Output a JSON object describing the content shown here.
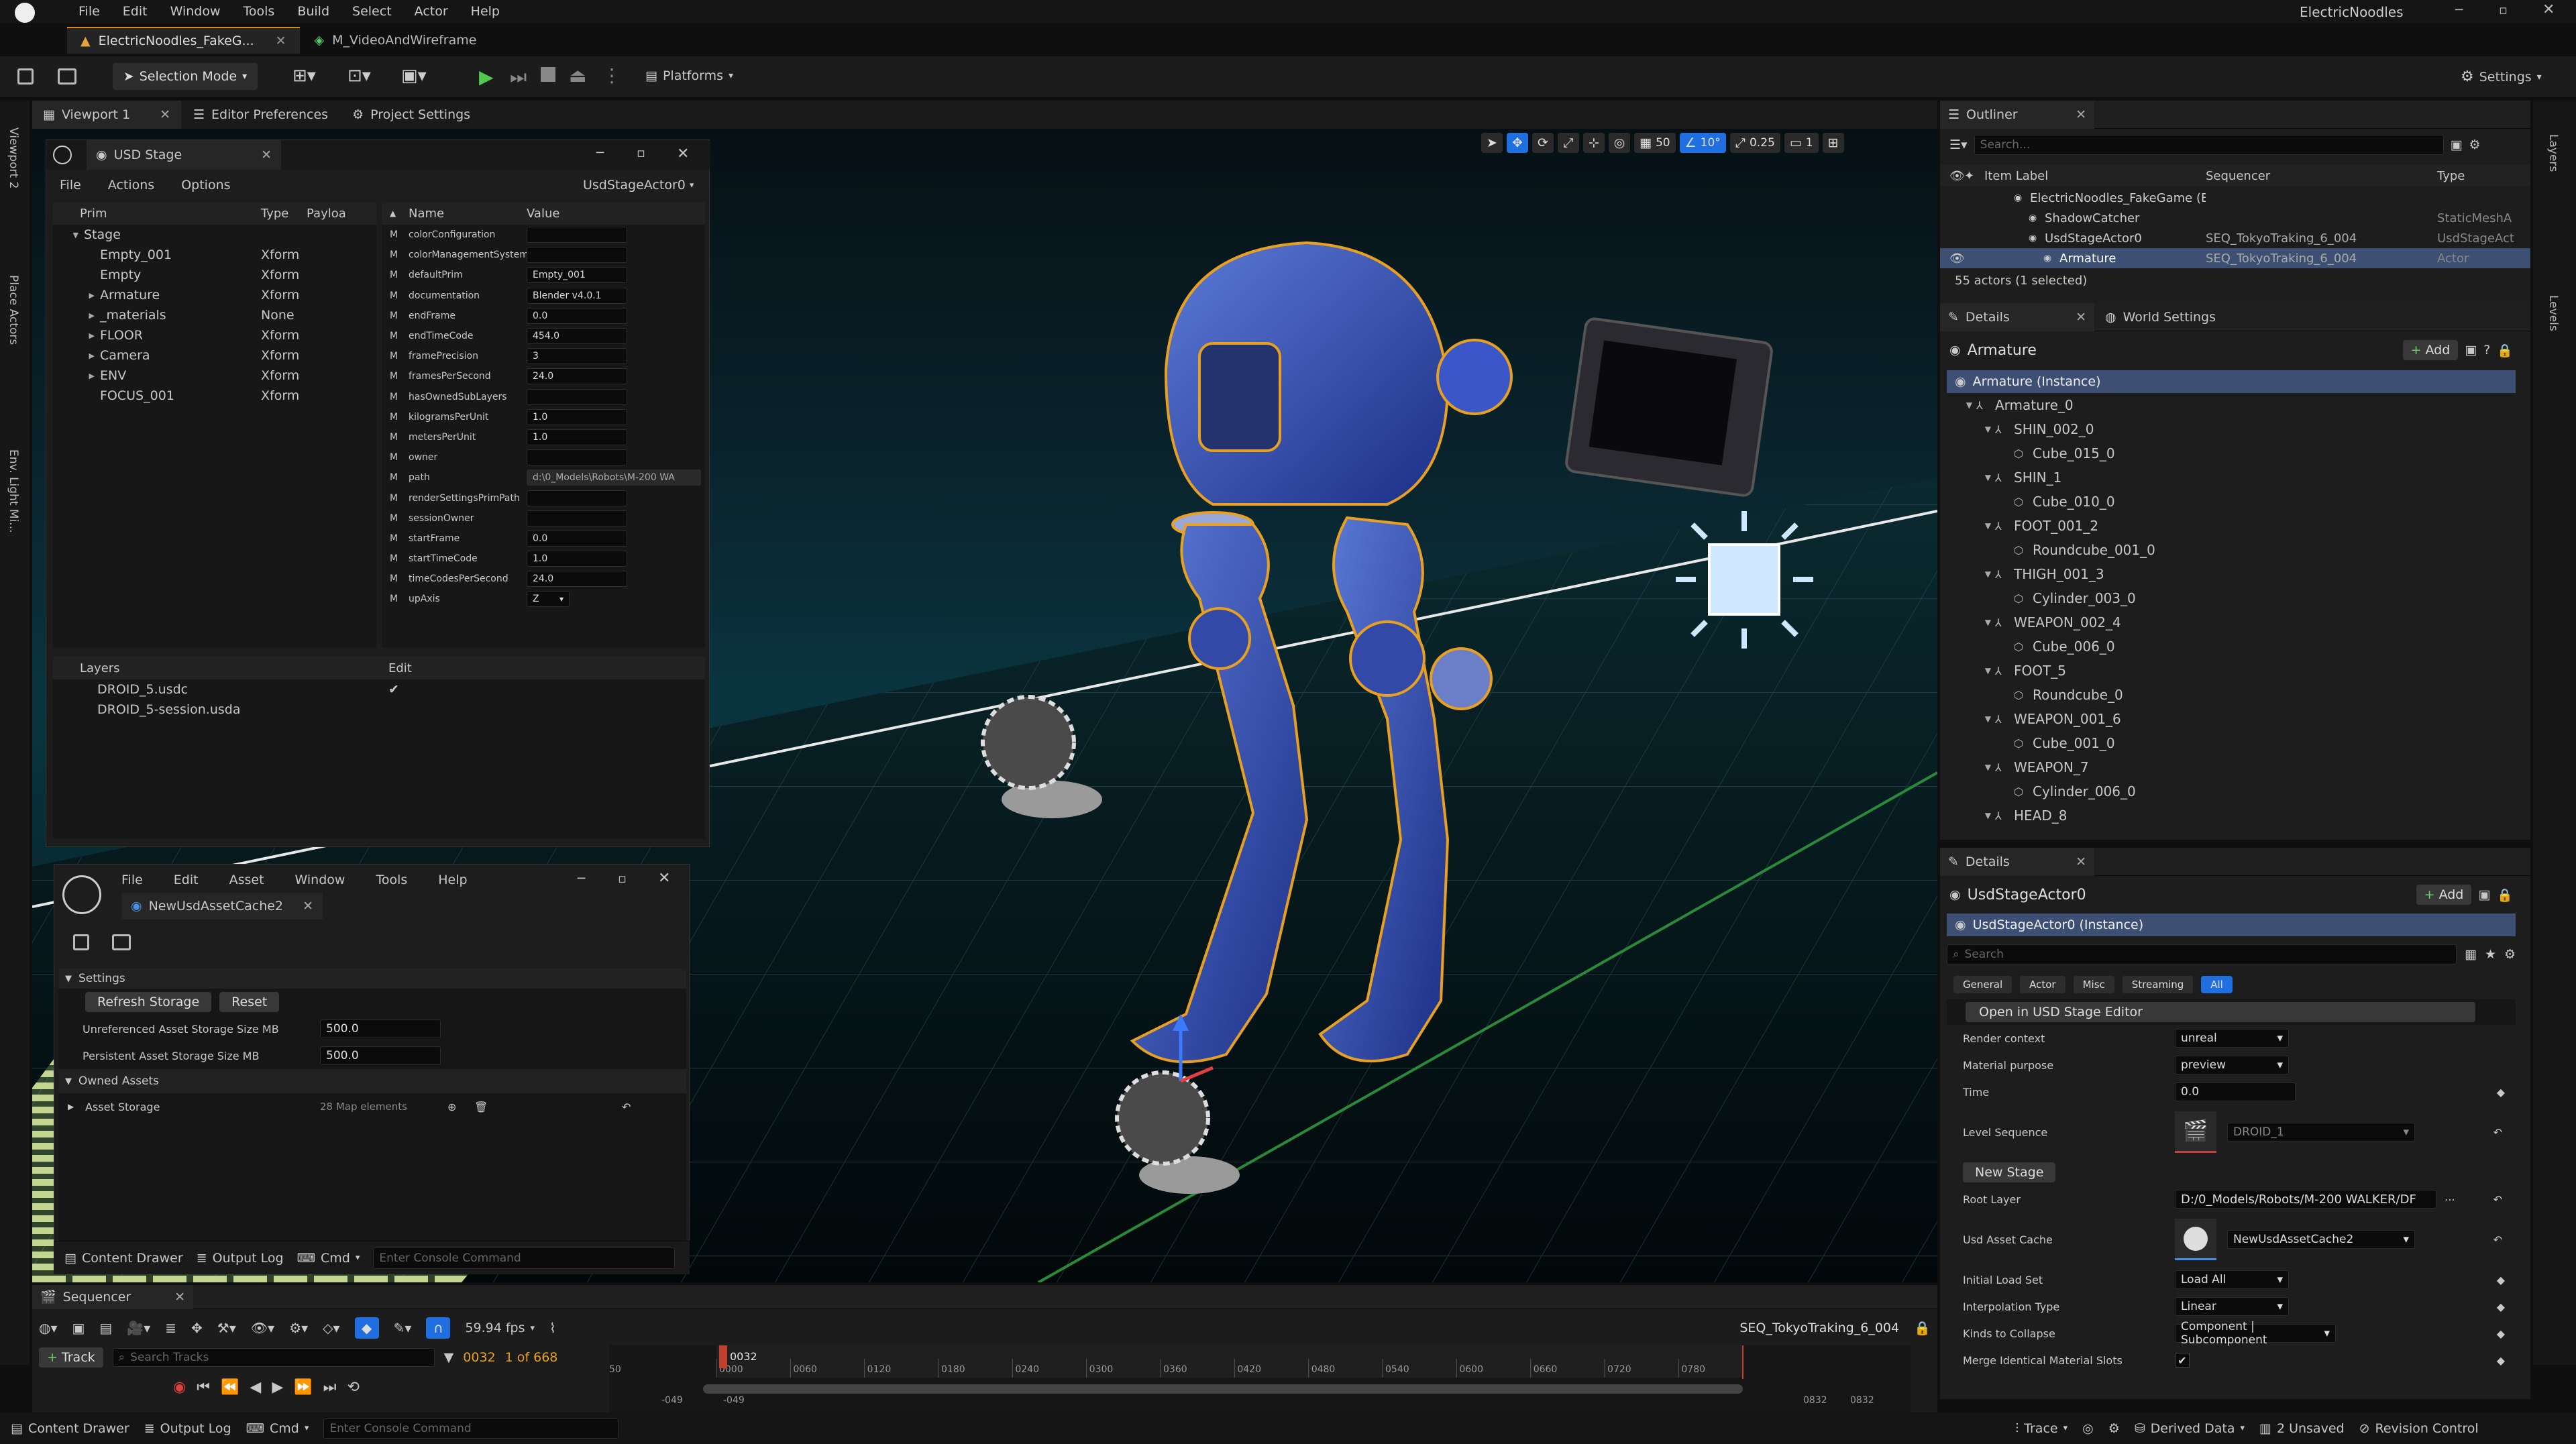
{
  "window": {
    "menus": [
      "File",
      "Edit",
      "Window",
      "Tools",
      "Build",
      "Select",
      "Actor",
      "Help"
    ],
    "project": "ElectricNoodles",
    "tabs": [
      {
        "label": "ElectricNoodles_FakeG...",
        "active": true
      },
      {
        "label": "M_VideoAndWireframe",
        "active": false
      }
    ]
  },
  "toolbar": {
    "mode": "Selection Mode",
    "platforms": "Platforms",
    "settings": "Settings"
  },
  "left_strip": [
    "Viewport 2",
    "Place Actors",
    "Env. Light Mi..."
  ],
  "right_strip": [
    "Layers",
    "Levels"
  ],
  "viewport_tabs": [
    {
      "label": "Viewport 1"
    },
    {
      "label": "Editor Preferences"
    },
    {
      "label": "Project Settings"
    }
  ],
  "viewport_toolbar": {
    "grid": "50",
    "angle": "10°",
    "scale": "0.25",
    "cam": "1"
  },
  "usd_stage": {
    "title": "USD Stage",
    "menus": [
      "File",
      "Actions",
      "Options"
    ],
    "actor": "UsdStageActor0",
    "prim_cols": [
      "Prim",
      "Type",
      "Payloa"
    ],
    "prims": [
      {
        "name": "Stage",
        "type": "",
        "indent": 0,
        "arrow": "down"
      },
      {
        "name": "Empty_001",
        "type": "Xform",
        "indent": 1,
        "arrow": ""
      },
      {
        "name": "Empty",
        "type": "Xform",
        "indent": 1,
        "arrow": ""
      },
      {
        "name": "Armature",
        "type": "Xform",
        "indent": 1,
        "arrow": "right"
      },
      {
        "name": "_materials",
        "type": "None",
        "indent": 1,
        "arrow": "right"
      },
      {
        "name": "FLOOR",
        "type": "Xform",
        "indent": 1,
        "arrow": "right"
      },
      {
        "name": "Camera",
        "type": "Xform",
        "indent": 1,
        "arrow": "right"
      },
      {
        "name": "ENV",
        "type": "Xform",
        "indent": 1,
        "arrow": "right"
      },
      {
        "name": "FOCUS_001",
        "type": "Xform",
        "indent": 1,
        "arrow": ""
      }
    ],
    "prop_cols": [
      "Name",
      "Value"
    ],
    "props": [
      {
        "m": "M",
        "name": "colorConfiguration",
        "value": ""
      },
      {
        "m": "M",
        "name": "colorManagementSystem",
        "value": ""
      },
      {
        "m": "M",
        "name": "defaultPrim",
        "value": "Empty_001"
      },
      {
        "m": "M",
        "name": "documentation",
        "value": "Blender v4.0.1"
      },
      {
        "m": "M",
        "name": "endFrame",
        "value": "0.0"
      },
      {
        "m": "M",
        "name": "endTimeCode",
        "value": "454.0"
      },
      {
        "m": "M",
        "name": "framePrecision",
        "value": "3"
      },
      {
        "m": "M",
        "name": "framesPerSecond",
        "value": "24.0"
      },
      {
        "m": "M",
        "name": "hasOwnedSubLayers",
        "value": ""
      },
      {
        "m": "M",
        "name": "kilogramsPerUnit",
        "value": "1.0"
      },
      {
        "m": "M",
        "name": "metersPerUnit",
        "value": "1.0"
      },
      {
        "m": "M",
        "name": "owner",
        "value": ""
      },
      {
        "m": "M",
        "name": "path",
        "value": "d:\\0_Models\\Robots\\M-200 WA"
      },
      {
        "m": "M",
        "name": "renderSettingsPrimPath",
        "value": ""
      },
      {
        "m": "M",
        "name": "sessionOwner",
        "value": ""
      },
      {
        "m": "M",
        "name": "startFrame",
        "value": "0.0"
      },
      {
        "m": "M",
        "name": "startTimeCode",
        "value": "1.0"
      },
      {
        "m": "M",
        "name": "timeCodesPerSecond",
        "value": "24.0"
      },
      {
        "m": "M",
        "name": "upAxis",
        "value": "Z"
      }
    ],
    "layers_cols": [
      "Layers",
      "Edit"
    ],
    "layers": [
      {
        "name": "DROID_5.usdc",
        "check": "✔"
      },
      {
        "name": "DROID_5-session.usda",
        "check": ""
      }
    ]
  },
  "asset_cache": {
    "menus": [
      "File",
      "Edit",
      "Asset",
      "Window",
      "Tools",
      "Help"
    ],
    "tab": "NewUsdAssetCache2",
    "settings": "Settings",
    "refresh": "Refresh Storage",
    "reset": "Reset",
    "unref_label": "Unreferenced Asset Storage Size MB",
    "unref_val": "500.0",
    "persist_label": "Persistent Asset Storage Size MB",
    "persist_val": "500.0",
    "owned": "Owned Assets",
    "storage": "Asset Storage",
    "storage_val": "28 Map elements",
    "content_drawer": "Content Drawer",
    "output_log": "Output Log",
    "cmd": "Cmd",
    "console": "Enter Console Command"
  },
  "outliner": {
    "title": "Outliner",
    "search": "Search...",
    "cols": [
      "Item Label",
      "Sequencer",
      "Type"
    ],
    "rows": [
      {
        "label": "ElectricNoodles_FakeGame (Editor)",
        "seq": "",
        "type": "",
        "indent": 2,
        "sel": false,
        "eye": false
      },
      {
        "label": "ShadowCatcher",
        "seq": "",
        "type": "StaticMeshA",
        "indent": 3,
        "sel": false,
        "eye": false
      },
      {
        "label": "UsdStageActor0",
        "seq": "SEQ_TokyoTraking_6_004",
        "type": "UsdStageAct",
        "indent": 3,
        "sel": false,
        "eye": false
      },
      {
        "label": "Armature",
        "seq": "SEQ_TokyoTraking_6_004",
        "type": "Actor",
        "indent": 4,
        "sel": true,
        "eye": true
      }
    ],
    "count": "55 actors (1 selected)"
  },
  "details1": {
    "tabs": [
      "Details",
      "World Settings"
    ],
    "name": "Armature",
    "add": "Add",
    "instance": "Armature (Instance)",
    "tree": [
      {
        "label": "Armature_0",
        "indent": 1,
        "type": "bone"
      },
      {
        "label": "SHIN_002_0",
        "indent": 2,
        "type": "bone"
      },
      {
        "label": "Cube_015_0",
        "indent": 3,
        "type": "mesh"
      },
      {
        "label": "SHIN_1",
        "indent": 2,
        "type": "bone"
      },
      {
        "label": "Cube_010_0",
        "indent": 3,
        "type": "mesh"
      },
      {
        "label": "FOOT_001_2",
        "indent": 2,
        "type": "bone"
      },
      {
        "label": "Roundcube_001_0",
        "indent": 3,
        "type": "mesh"
      },
      {
        "label": "THIGH_001_3",
        "indent": 2,
        "type": "bone"
      },
      {
        "label": "Cylinder_003_0",
        "indent": 3,
        "type": "mesh"
      },
      {
        "label": "WEAPON_002_4",
        "indent": 2,
        "type": "bone"
      },
      {
        "label": "Cube_006_0",
        "indent": 3,
        "type": "mesh"
      },
      {
        "label": "FOOT_5",
        "indent": 2,
        "type": "bone"
      },
      {
        "label": "Roundcube_0",
        "indent": 3,
        "type": "mesh"
      },
      {
        "label": "WEAPON_001_6",
        "indent": 2,
        "type": "bone"
      },
      {
        "label": "Cube_001_0",
        "indent": 3,
        "type": "mesh"
      },
      {
        "label": "WEAPON_7",
        "indent": 2,
        "type": "bone"
      },
      {
        "label": "Cylinder_006_0",
        "indent": 3,
        "type": "mesh"
      },
      {
        "label": "HEAD_8",
        "indent": 2,
        "type": "bone"
      }
    ]
  },
  "details2": {
    "tab": "Details",
    "name": "UsdStageActor0",
    "add": "Add",
    "instance": "UsdStageActor0 (Instance)",
    "search": "Search",
    "filters": [
      "General",
      "Actor",
      "Misc",
      "Streaming",
      "All"
    ],
    "open_editor": "Open in USD Stage Editor",
    "render_context_label": "Render context",
    "render_context": "unreal",
    "material_purpose_label": "Material purpose",
    "material_purpose": "preview",
    "time_label": "Time",
    "time": "0.0",
    "level_seq_label": "Level Sequence",
    "level_seq": "DROID_1",
    "new_stage": "New Stage",
    "root_layer_label": "Root Layer",
    "root_layer": "D:/0_Models/Robots/M-200 WALKER/DF",
    "asset_cache_label": "Usd Asset Cache",
    "asset_cache": "NewUsdAssetCache2",
    "load_set_label": "Initial Load Set",
    "load_set": "Load All",
    "interp_label": "Interpolation Type",
    "interp": "Linear",
    "kinds_label": "Kinds to Collapse",
    "kinds": "Component | Subcomponent",
    "merge_label": "Merge Identical Material Slots"
  },
  "sequencer": {
    "title": "Sequencer",
    "fps": "59.94 fps",
    "seq_name": "SEQ_TokyoTraking_6_004",
    "track": "Track",
    "search": "Search Tracks",
    "frame": "0032",
    "of": "1 of 668",
    "playhead": "0032",
    "ticks": [
      "0000",
      "0060",
      "0120",
      "0180",
      "0240",
      "0300",
      "0360",
      "0420",
      "0480",
      "0540",
      "0600",
      "0660",
      "0720",
      "0780"
    ],
    "left_labels": [
      "-049",
      "-049"
    ],
    "right_labels": [
      "0832",
      "0832"
    ],
    "tick50": "50"
  },
  "statusbar": {
    "content_drawer": "Content Drawer",
    "output_log": "Output Log",
    "cmd": "Cmd",
    "console": "Enter Console Command",
    "trace": "Trace",
    "derived": "Derived Data",
    "unsaved": "2 Unsaved",
    "revision": "Revision Control"
  }
}
